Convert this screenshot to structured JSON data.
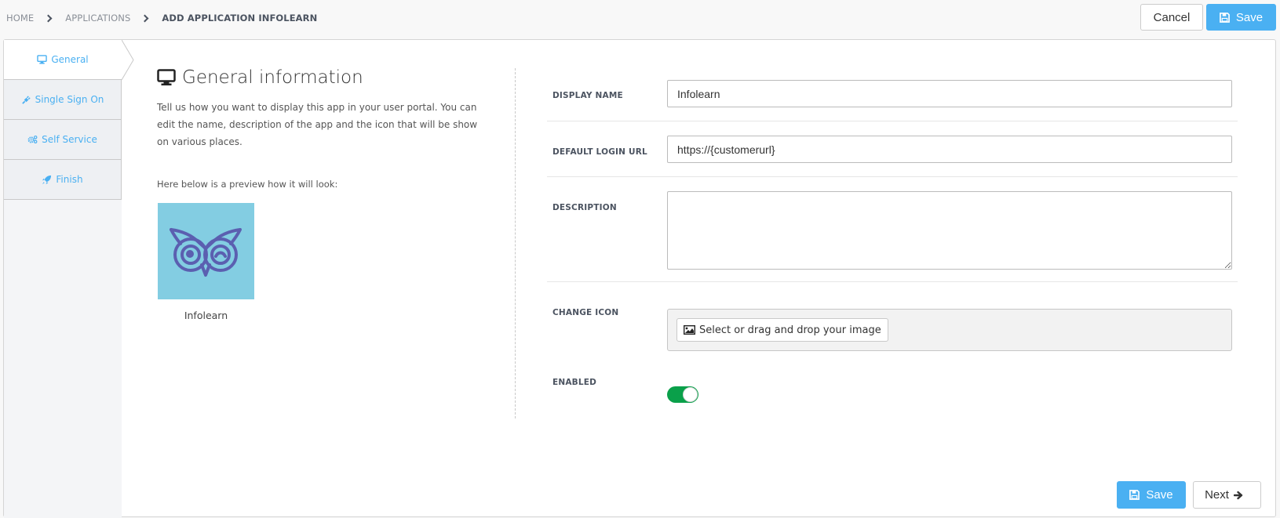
{
  "breadcrumb": {
    "items": [
      "HOME",
      "APPLICATIONS",
      "ADD APPLICATION INFOLEARN"
    ]
  },
  "header_actions": {
    "cancel_label": "Cancel",
    "save_label": "Save",
    "save_icon": "floppy-disk-icon"
  },
  "steps": [
    {
      "label": "General",
      "icon": "desktop-icon",
      "active": true
    },
    {
      "label": "Single Sign On",
      "icon": "plug-icon",
      "active": false
    },
    {
      "label": "Self Service",
      "icon": "cogs-icon",
      "active": false
    },
    {
      "label": "Finish",
      "icon": "rocket-icon",
      "active": false
    }
  ],
  "general": {
    "title": "General information",
    "title_icon": "desktop-icon",
    "intro": "Tell us how you want to display this app in your user portal. You can edit the name, description of the app and the icon that will be show on various places.",
    "preview_label": "Here below is a preview how it will look:",
    "preview_app_name": "Infolearn",
    "preview_tile_color": "#83cde2",
    "preview_logo_color": "#5b5fb0"
  },
  "form": {
    "display_name": {
      "label": "DISPLAY NAME",
      "value": "Infolearn"
    },
    "default_login_url": {
      "label": "DEFAULT LOGIN URL",
      "value": "https://{customerurl}"
    },
    "description": {
      "label": "DESCRIPTION",
      "value": ""
    },
    "change_icon": {
      "label": "CHANGE ICON",
      "button_label": "Select or drag and drop your image",
      "button_icon": "image-icon"
    },
    "enabled": {
      "label": "ENABLED",
      "value": true
    }
  },
  "footer_actions": {
    "save_label": "Save",
    "next_label": "Next",
    "next_icon": "arrow-right-icon"
  },
  "colors": {
    "accent": "#4ab0f2",
    "toggle_on": "#0aa04a"
  }
}
